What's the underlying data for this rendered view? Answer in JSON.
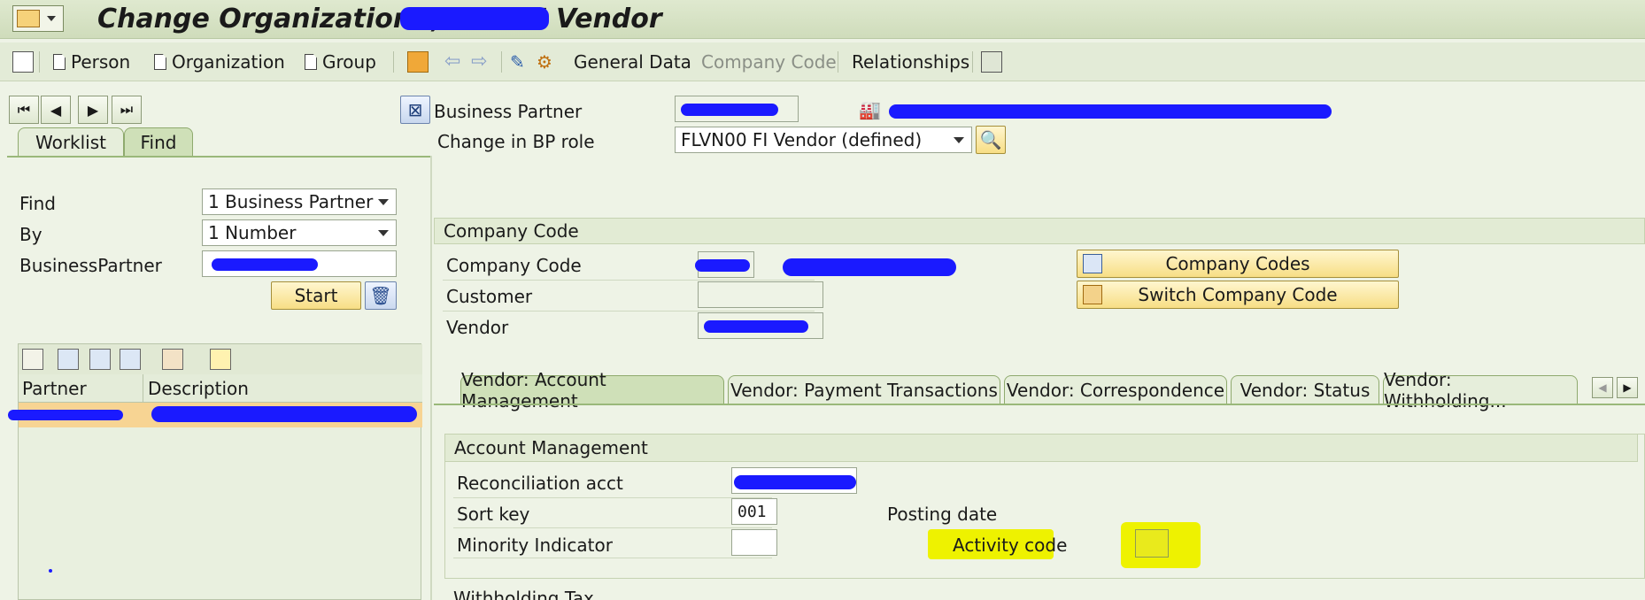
{
  "window": {
    "title": "Change Organization: , role FI Vendor"
  },
  "toolbar": {
    "person": "Person",
    "organization": "Organization",
    "group": "Group",
    "general_data": "General Data",
    "company_code": "Company Code",
    "relationships": "Relationships"
  },
  "left": {
    "tabs": [
      "Worklist",
      "Find"
    ],
    "find_label": "Find",
    "find_value": "1 Business Partner",
    "by_label": "By",
    "by_value": "1 Number",
    "bp_label": "BusinessPartner",
    "start_button": "Start",
    "columns": [
      "Partner",
      "Description"
    ]
  },
  "header": {
    "bp_label": "Business Partner",
    "role_label": "Change in BP role",
    "role_value": "FLVN00 FI Vendor (defined)"
  },
  "company_section": {
    "title": "Company Code",
    "company_code_label": "Company Code",
    "customer_label": "Customer",
    "vendor_label": "Vendor",
    "company_codes_button": "Company Codes",
    "switch_button": "Switch Company Code"
  },
  "vendor_tabs": [
    "Vendor: Account Management",
    "Vendor: Payment Transactions",
    "Vendor: Correspondence",
    "Vendor: Status",
    "Vendor: Withholding..."
  ],
  "account_mgmt": {
    "title": "Account Management",
    "reconciliation_label": "Reconciliation acct",
    "sort_key_label": "Sort key",
    "sort_key_value": "001",
    "minority_label": "Minority Indicator",
    "posting_date_label": "Posting date",
    "activity_code_label": "Activity code",
    "next_section": "Withholding Tax"
  },
  "colors": {
    "highlight": "#eef200",
    "redaction": "#1a1aff",
    "button": "#f7de85"
  }
}
